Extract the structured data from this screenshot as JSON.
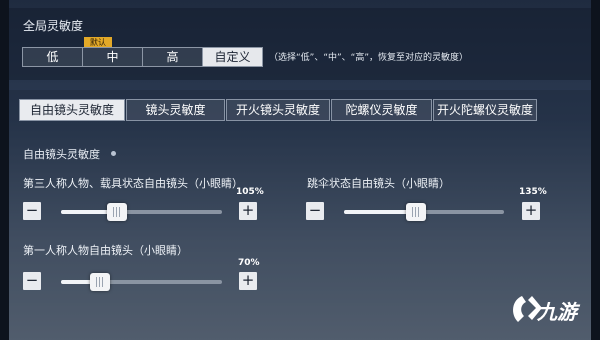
{
  "global": {
    "title": "全局灵敏度",
    "default_tag": "默认",
    "presets": [
      {
        "label": "低",
        "active": false
      },
      {
        "label": "中",
        "active": false
      },
      {
        "label": "高",
        "active": false
      },
      {
        "label": "自定义",
        "active": true
      }
    ],
    "hint": "（选择“低”、“中”、“高”，恢复至对应的灵敏度）"
  },
  "tabs": [
    {
      "label": "自由镜头灵敏度",
      "active": true
    },
    {
      "label": "镜头灵敏度",
      "active": false
    },
    {
      "label": "开火镜头灵敏度",
      "active": false
    },
    {
      "label": "陀螺仪灵敏度",
      "active": false
    },
    {
      "label": "开火陀螺仪灵敏度",
      "active": false
    }
  ],
  "free_camera": {
    "title": "自由镜头灵敏度",
    "sliders": [
      {
        "label": "第三人称人物、载具状态自由镜头（小眼睛）",
        "value_text": "105%",
        "fraction": 0.35
      },
      {
        "label": "跳伞状态自由镜头（小眼睛）",
        "value_text": "135%",
        "fraction": 0.45
      },
      {
        "label": "第一人称人物自由镜头（小眼睛）",
        "value_text": "70%",
        "fraction": 0.24
      }
    ],
    "minus_symbol": "−",
    "plus_symbol": "+"
  },
  "watermark": {
    "text": "九游",
    "icon": "jiuyou-logo-icon"
  },
  "colors": {
    "active_bg": "#e9ebef",
    "default_tag": "#e3a928"
  }
}
